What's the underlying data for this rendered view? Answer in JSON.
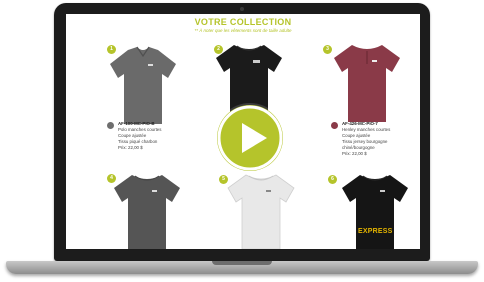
{
  "collection": {
    "title": "VOTRE COLLECTION",
    "subtitle": "** À noter que les vêtements sont de taille adulte"
  },
  "products": [
    {
      "number": "1",
      "color": "#6e6e6e",
      "code": "AF-100-MC-PIO-B",
      "lines": [
        "Polo manches courtes",
        "Coupe ajustée",
        "Tissu piqué charbon",
        "Prix: 22,00 $"
      ]
    },
    {
      "number": "2",
      "color": "#1b1b1b"
    },
    {
      "number": "3",
      "color": "#8a3a48",
      "code": "AF-426-MC-PIO-7",
      "lines": [
        "Henley manches courtes",
        "Coupe ajustée",
        "Tissu jersey bourgogne",
        "chiné/bourgogne",
        "Prix: 22,00 $"
      ]
    },
    {
      "number": "4",
      "color": "#555555"
    },
    {
      "number": "5",
      "color": "#e8e8e8"
    },
    {
      "number": "6",
      "color": "#151515",
      "badge": "EXPRESS"
    }
  ],
  "video": {
    "play_icon": "play-icon",
    "accent": "#b5c42b"
  }
}
